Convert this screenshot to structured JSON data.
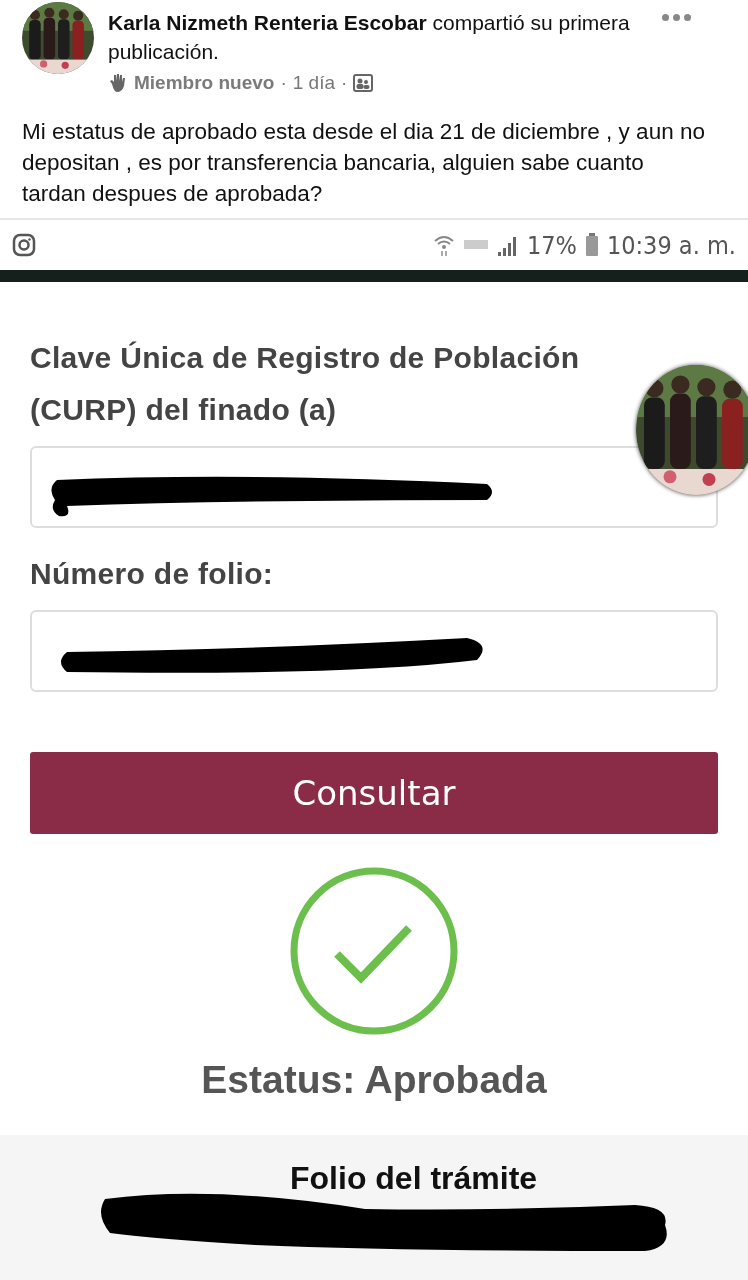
{
  "post": {
    "author": "Karla Nizmeth Renteria Escobar",
    "action": "compartió su primera publicación.",
    "badge": "Miembro nuevo",
    "separator": "·",
    "time": "1 día",
    "body": "Mi estatus de aprobado esta desde el dia 21 de diciembre , y aun no depositan , es por transferencia bancaria, alguien sabe cuanto tardan despues de aprobada?"
  },
  "status_bar": {
    "battery": "17%",
    "time": "10:39 a. m."
  },
  "form": {
    "fields": [
      {
        "label": "Clave Única de Registro de Población (CURP) del finado (a)",
        "redacted": true
      },
      {
        "label": "Número de folio:",
        "redacted": true
      }
    ],
    "button": "Consultar",
    "status": "Estatus: Aprobada",
    "folio_heading": "Folio del trámite"
  }
}
